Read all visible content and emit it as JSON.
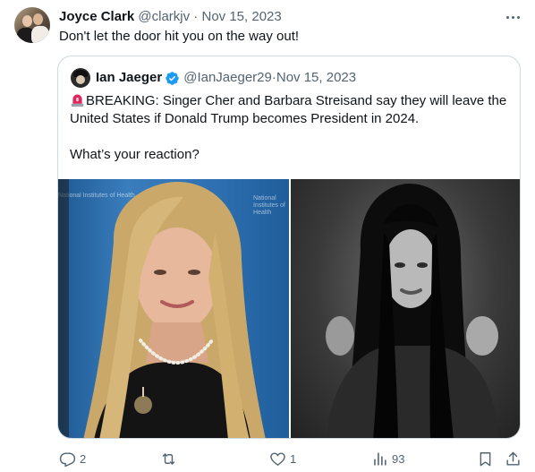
{
  "tweet": {
    "author_name": "Joyce Clark",
    "author_handle": "@clarkjv",
    "date": "Nov 15, 2023",
    "separator": " · ",
    "text": "Don't let the door hit you on the way out!"
  },
  "quoted_tweet": {
    "author_name": "Ian Jaeger",
    "author_handle": "@IanJaeger29",
    "date": "Nov 15, 2023",
    "separator": " · ",
    "line1": "BREAKING: Singer Cher and Barbara Streisand say they will leave the United States if Donald Trump becomes President in 2024.",
    "line2": "What’s your reaction?",
    "media": [
      {
        "icon": "photo-woman-blonde",
        "watermark": "National Institutes of Health"
      },
      {
        "icon": "photo-woman-dark-hair"
      }
    ]
  },
  "actions": {
    "replies": "2",
    "reposts": "",
    "likes": "1",
    "views": "93"
  },
  "colors": {
    "text": "#0f1419",
    "muted": "#536471",
    "border": "#cfd9de",
    "verified": "#1d9bf0",
    "siren": "#e0245e"
  }
}
